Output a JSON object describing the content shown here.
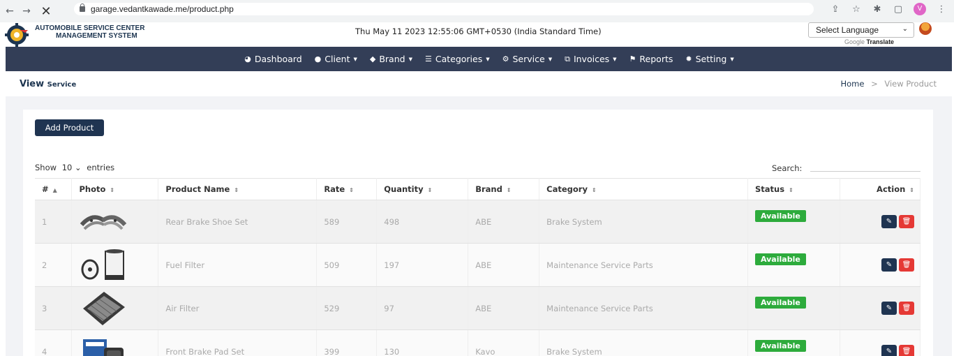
{
  "browser": {
    "url": "garage.vedantkawade.me/product.php",
    "profile_initial": "V"
  },
  "header": {
    "brand_line1": "AUTOMOBILE SERVICE CENTER",
    "brand_line2": "MANAGEMENT SYSTEM",
    "datetime": "Thu May 11 2023 12:55:06 GMT+0530 (India Standard Time)",
    "language_select": "Select Language",
    "powered_by_prefix": "Google",
    "powered_by": "Translate"
  },
  "nav": {
    "items": [
      {
        "label": "Dashboard",
        "icon": "dashboard-icon",
        "glyph": "◕",
        "dropdown": false
      },
      {
        "label": "Client",
        "icon": "user-icon",
        "glyph": "👤",
        "dropdown": true
      },
      {
        "label": "Brand",
        "icon": "tag-icon",
        "glyph": "🏷",
        "dropdown": true
      },
      {
        "label": "Categories",
        "icon": "list-icon",
        "glyph": "☰",
        "dropdown": true
      },
      {
        "label": "Service",
        "icon": "cogs-icon",
        "glyph": "⚙",
        "dropdown": true
      },
      {
        "label": "Invoices",
        "icon": "copy-icon",
        "glyph": "⧉",
        "dropdown": true
      },
      {
        "label": "Reports",
        "icon": "flag-icon",
        "glyph": "⚑",
        "dropdown": false
      },
      {
        "label": "Setting",
        "icon": "gear-icon",
        "glyph": "✹",
        "dropdown": true
      }
    ]
  },
  "page": {
    "title": "View",
    "title_small": "Service",
    "breadcrumb_home": "Home",
    "breadcrumb_sep": ">",
    "breadcrumb_current": "View Product"
  },
  "toolbar": {
    "add_label": "Add Product",
    "show_prefix": "Show",
    "show_value": "10",
    "show_suffix": "entries",
    "search_label": "Search:"
  },
  "table": {
    "columns": [
      "#",
      "Photo",
      "Product Name",
      "Rate",
      "Quantity",
      "Brand",
      "Category",
      "Status",
      "Action"
    ],
    "rows": [
      {
        "num": "1",
        "name": "Rear Brake Shoe Set",
        "rate": "589",
        "qty": "498",
        "brand": "ABE",
        "category": "Brake System",
        "status": "Available",
        "photo": "brake-shoe"
      },
      {
        "num": "2",
        "name": "Fuel Filter",
        "rate": "509",
        "qty": "197",
        "brand": "ABE",
        "category": "Maintenance Service Parts",
        "status": "Available",
        "photo": "fuel-filter"
      },
      {
        "num": "3",
        "name": "Air Filter",
        "rate": "529",
        "qty": "97",
        "brand": "ABE",
        "category": "Maintenance Service Parts",
        "status": "Available",
        "photo": "air-filter"
      },
      {
        "num": "4",
        "name": "Front Brake Pad Set",
        "rate": "399",
        "qty": "130",
        "brand": "Kavo",
        "category": "Brake System",
        "status": "Available",
        "photo": "brake-pad"
      }
    ]
  },
  "colors": {
    "navbar": "#333e57",
    "primary": "#1f3451",
    "status_available": "#2dab3c",
    "delete": "#e53935"
  }
}
